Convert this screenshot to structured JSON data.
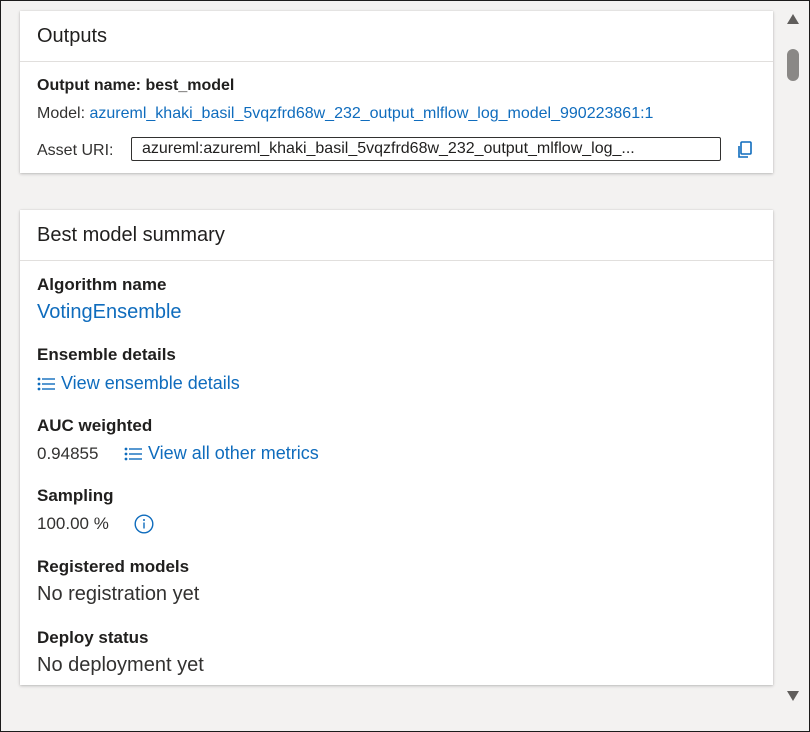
{
  "outputs": {
    "title": "Outputs",
    "output_name_label": "Output name: best_model",
    "model_label": "Model:",
    "model_link": "azureml_khaki_basil_5vqzfrd68w_232_output_mlflow_log_model_990223861:1",
    "asset_uri_label": "Asset URI:",
    "asset_uri_value": "azureml:azureml_khaki_basil_5vqzfrd68w_232_output_mlflow_log_..."
  },
  "summary": {
    "title": "Best model summary",
    "algorithm_title": "Algorithm name",
    "algorithm_value": "VotingEnsemble",
    "ensemble_title": "Ensemble details",
    "ensemble_link": "View ensemble details",
    "auc_title": "AUC weighted",
    "auc_value": "0.94855",
    "metrics_link": "View all other metrics",
    "sampling_title": "Sampling",
    "sampling_value": "100.00 %",
    "registered_title": "Registered models",
    "registered_value": "No registration yet",
    "deploy_title": "Deploy status",
    "deploy_value": "No deployment yet"
  },
  "icons": {
    "copy": "copy-icon",
    "list": "list-icon",
    "info": "info-icon",
    "scroll_up": "scroll-up-arrow",
    "scroll_down": "scroll-down-arrow"
  },
  "colors": {
    "link": "#0f6cbd",
    "background": "#f3f2f1",
    "card": "#ffffff"
  }
}
